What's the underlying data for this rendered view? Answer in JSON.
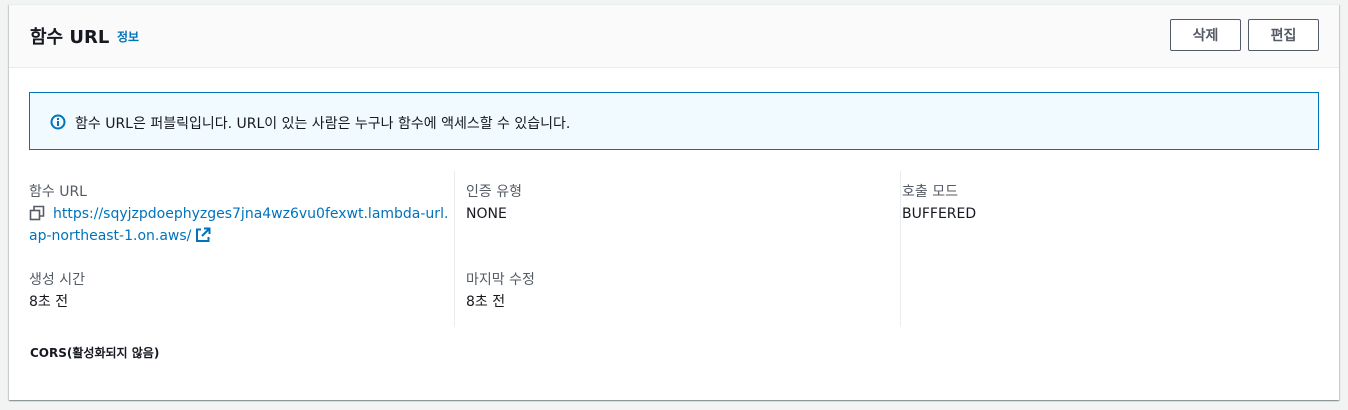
{
  "header": {
    "title": "함수 URL",
    "info_label": "정보",
    "delete_label": "삭제",
    "edit_label": "편집"
  },
  "alert": {
    "icon": "info-icon",
    "text": "함수 URL은 퍼블릭입니다. URL이 있는 사람은 누구나 함수에 액세스할 수 있습니다."
  },
  "details": {
    "function_url": {
      "label": "함수 URL",
      "value": "https://sqyjzpdoephyzges7jna4wz6vu0fexwt.lambda-url.ap-northeast-1.on.aws/"
    },
    "auth_type": {
      "label": "인증 유형",
      "value": "NONE"
    },
    "invoke_mode": {
      "label": "호출 모드",
      "value": "BUFFERED"
    },
    "created": {
      "label": "생성 시간",
      "value": "8초 전"
    },
    "last_modified": {
      "label": "마지막 수정",
      "value": "8초 전"
    }
  },
  "cors": {
    "text": "CORS(활성화되지 않음)"
  },
  "colors": {
    "link": "#0073bb",
    "alert_bg": "#f1faff",
    "alert_border": "#0073bb"
  }
}
